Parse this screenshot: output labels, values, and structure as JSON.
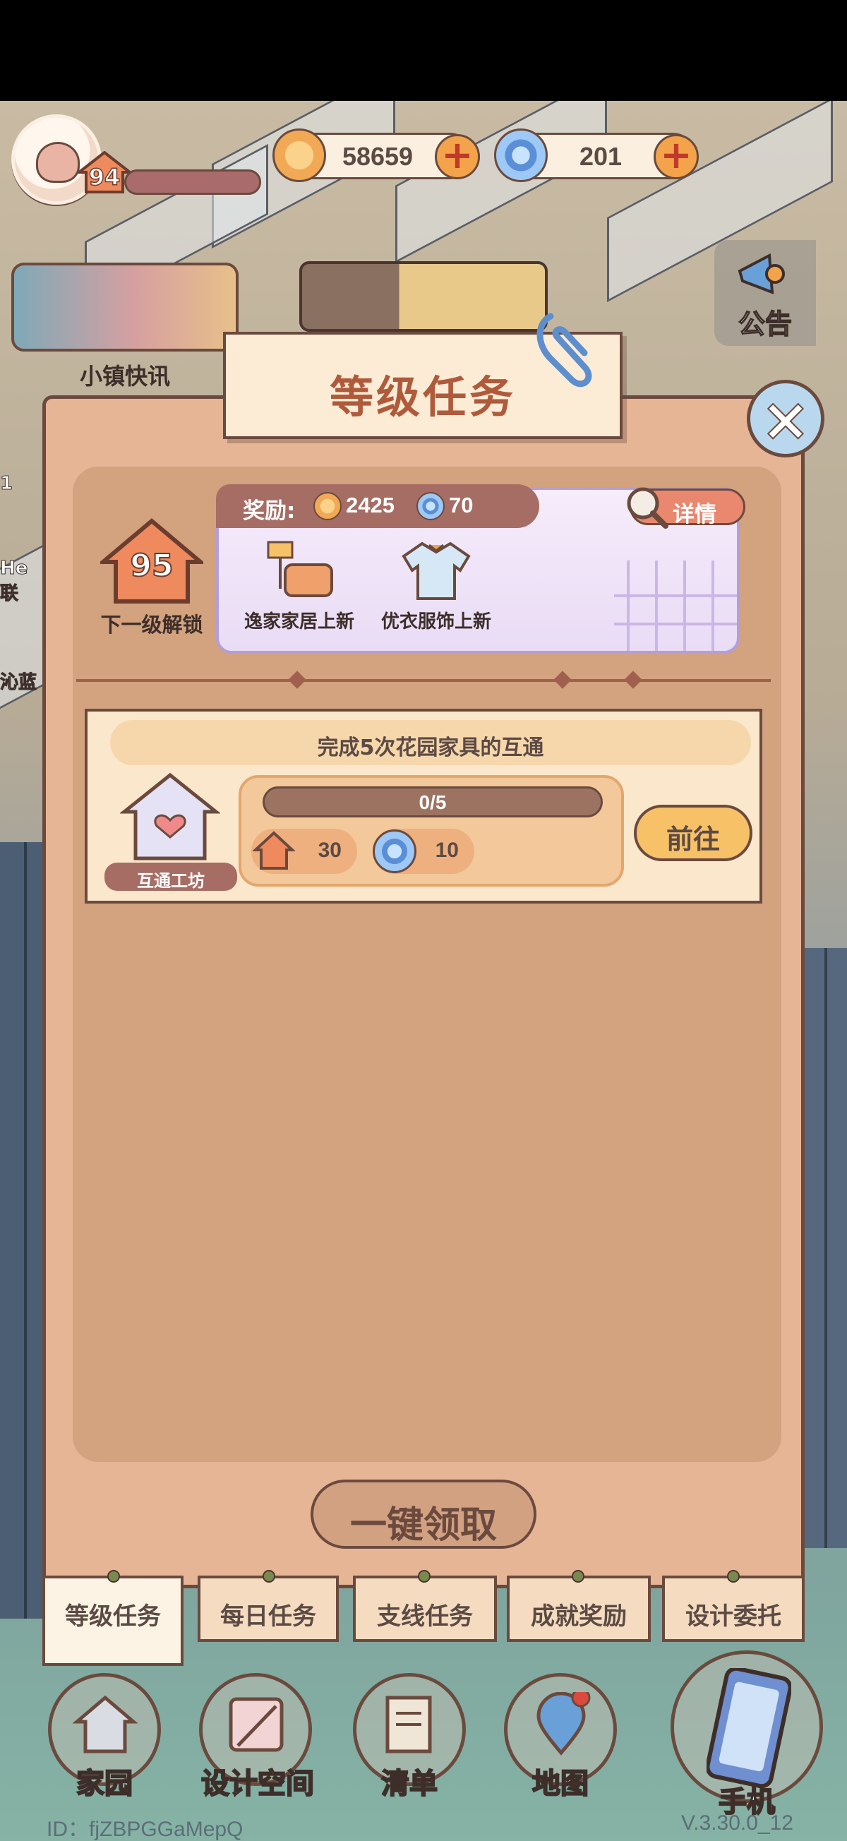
{
  "hud": {
    "player_level": "94",
    "gold_amount": "58659",
    "gem_amount": "201",
    "news_label": "小镇快讯",
    "notice_label": "公告",
    "side_peek": [
      "1",
      "He",
      "联",
      "沁蓝"
    ]
  },
  "panel": {
    "title": "等级任务",
    "next_level": "95",
    "next_level_label": "下一级解锁",
    "reward_label": "奖励:",
    "reward_gold": "2425",
    "reward_gem": "70",
    "detail_label": "详情",
    "reward_items": [
      {
        "label": "逸家家居上新",
        "icon": "sofa-lamp-icon"
      },
      {
        "label": "优衣服饰上新",
        "icon": "shirt-icon"
      }
    ],
    "task": {
      "title": "完成5次花园家具的互通",
      "source_label": "互通工坊",
      "progress_text": "0/5",
      "progress_fraction": 0,
      "reward_exp": "30",
      "reward_gem": "10",
      "go_label": "前往"
    },
    "claim_all_label": "一键领取"
  },
  "tabs": [
    {
      "label": "等级任务",
      "active": true
    },
    {
      "label": "每日任务",
      "active": false
    },
    {
      "label": "支线任务",
      "active": false
    },
    {
      "label": "成就奖励",
      "active": false
    },
    {
      "label": "设计委托",
      "active": false
    }
  ],
  "nav": [
    {
      "label": "家园",
      "icon": "home-icon"
    },
    {
      "label": "设计空间",
      "icon": "design-icon"
    },
    {
      "label": "清单",
      "icon": "list-icon"
    },
    {
      "label": "地图",
      "icon": "map-pin-icon"
    },
    {
      "label": "手机",
      "icon": "phone-icon"
    }
  ],
  "footer": {
    "id_text": "ID：fjZBPGGaMepQ",
    "version": "V.3.30.0_12"
  },
  "colors": {
    "panel_bg": "#e6b596",
    "panel_inner": "#d3a27e",
    "accent_orange": "#f3a34a",
    "title_text": "#b05a3c",
    "outline": "#6b4a3e"
  }
}
